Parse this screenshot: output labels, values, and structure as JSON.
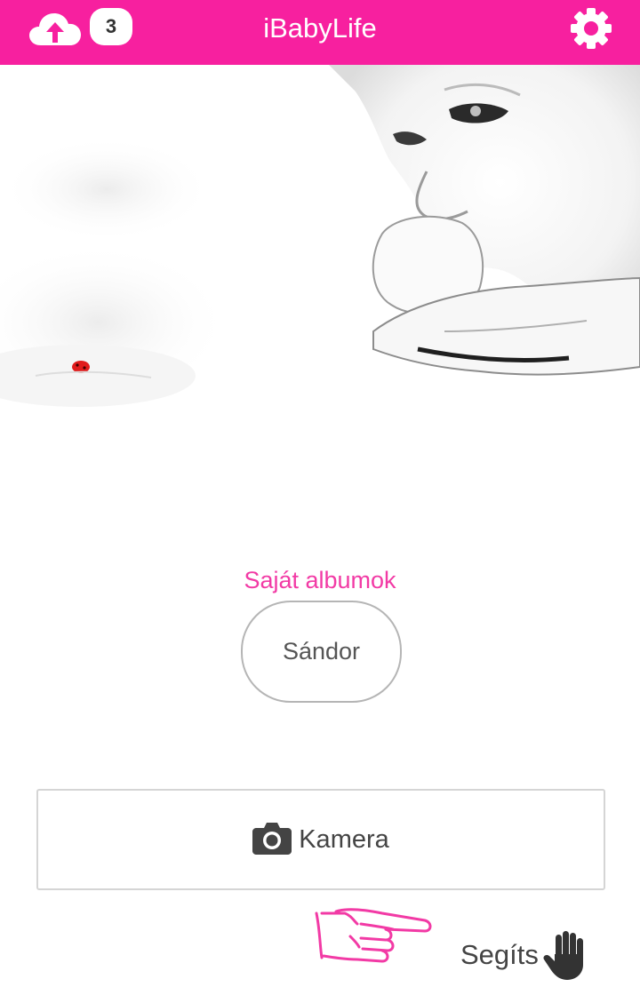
{
  "header": {
    "title": "iBabyLife",
    "upload_count": "3",
    "upload_icon": "cloud-upload-icon",
    "settings_icon": "gear-icon"
  },
  "hero": {
    "image": "baby-sketch-illustration"
  },
  "albums": {
    "heading": "Saját albumok",
    "items": [
      {
        "label": "Sándor"
      }
    ]
  },
  "actions": {
    "camera_label": "Kamera",
    "camera_icon": "camera-icon",
    "help_label": "Segíts",
    "help_icon": "raised-hand-icon",
    "pointer_icon": "pointing-hand-icon"
  },
  "colors": {
    "brand": "#f7209f",
    "heading": "#f23aa5",
    "ladybug": "#e11b1b"
  }
}
